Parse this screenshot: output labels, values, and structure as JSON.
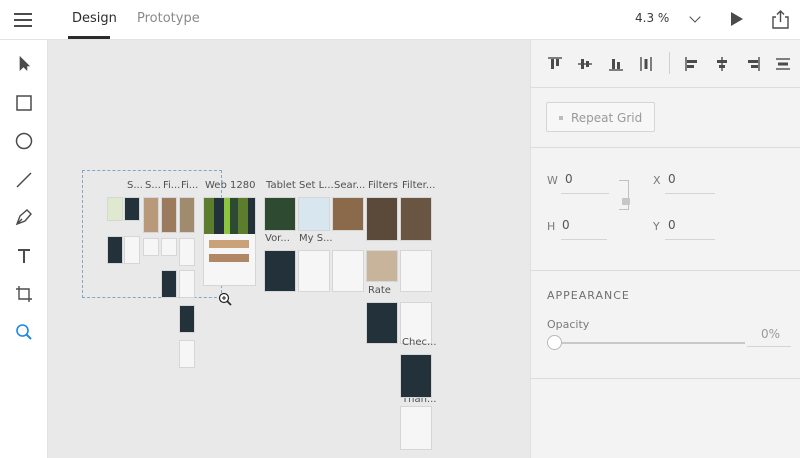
{
  "topbar": {
    "tabs": [
      {
        "label": "Design",
        "active": true
      },
      {
        "label": "Prototype",
        "active": false
      }
    ],
    "zoom": "4.3 %"
  },
  "tools": [
    "select-arrow-icon",
    "rectangle-icon",
    "ellipse-icon",
    "line-icon",
    "pen-icon",
    "text-icon",
    "artboard-icon",
    "zoom-icon"
  ],
  "canvas": {
    "artboard_labels": [
      {
        "text": "S...",
        "name": "label-s1"
      },
      {
        "text": "S...",
        "name": "label-s2"
      },
      {
        "text": "Fi...",
        "name": "label-fi1"
      },
      {
        "text": "Fi...",
        "name": "label-fi2"
      },
      {
        "text": "Web 1280",
        "name": "label-web-1280"
      },
      {
        "text": "Tablet",
        "name": "label-tablet"
      },
      {
        "text": "Set L...",
        "name": "label-set-l"
      },
      {
        "text": "Sear...",
        "name": "label-sear"
      },
      {
        "text": "Filters",
        "name": "label-filters"
      },
      {
        "text": "Filter...",
        "name": "label-filter-2"
      },
      {
        "text": "Vor...",
        "name": "label-vor"
      },
      {
        "text": "My S...",
        "name": "label-my-s"
      },
      {
        "text": "Rate",
        "name": "label-rate"
      },
      {
        "text": "Chec...",
        "name": "label-chec"
      },
      {
        "text": "Than...",
        "name": "label-than"
      }
    ]
  },
  "panel": {
    "repeat_grid": "Repeat Grid",
    "w_label": "W",
    "w_value": "0",
    "h_label": "H",
    "h_value": "0",
    "x_label": "X",
    "x_value": "0",
    "y_label": "Y",
    "y_value": "0",
    "appearance": "APPEARANCE",
    "opacity_label": "Opacity",
    "opacity_value": "0%"
  },
  "colors": {
    "accent": "#1e88e5",
    "brand_green": "#8cc63f",
    "dark_card": "#23313a"
  }
}
